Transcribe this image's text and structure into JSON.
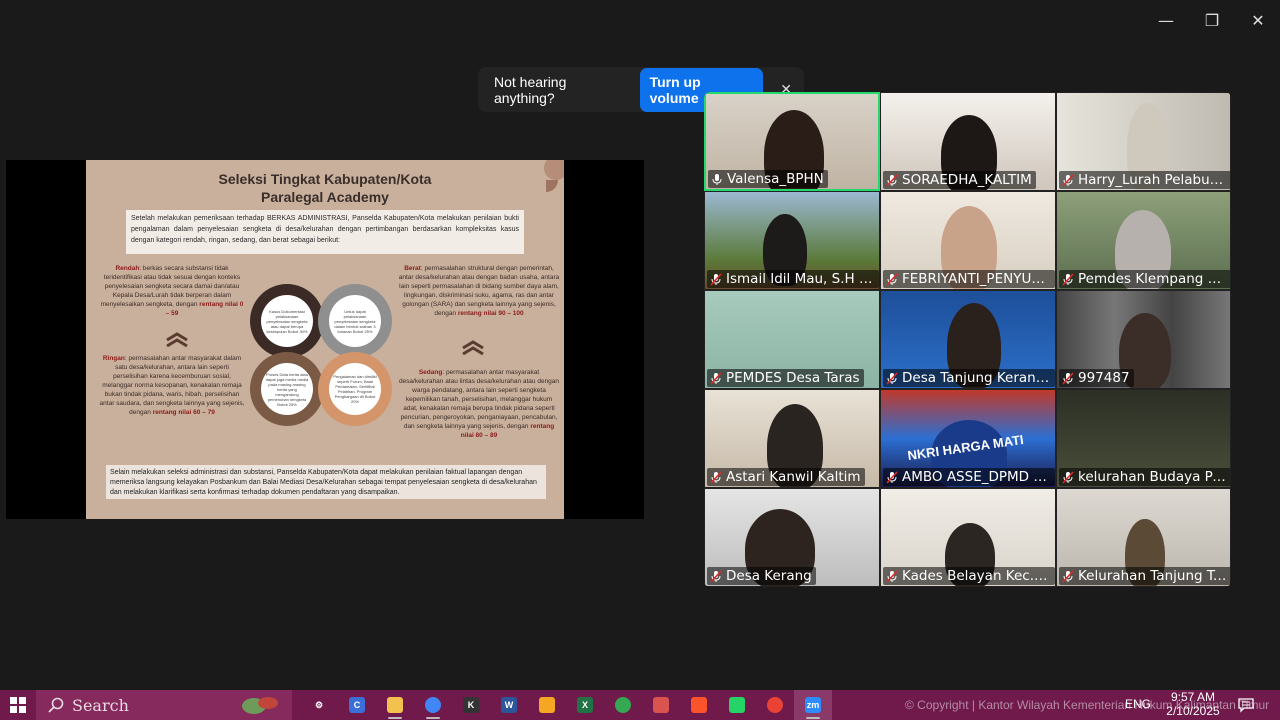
{
  "window": {
    "minimize_icon": "minimize-icon",
    "restore_icon": "restore-icon",
    "close_icon": "close-icon"
  },
  "notification": {
    "message": "Not hearing anything?",
    "button": "Turn up volume",
    "close": "✕"
  },
  "slide": {
    "title_line1": "Seleksi Tingkat Kabupaten/Kota",
    "title_line2": "Paralegal Academy",
    "intro": "Setelah melakukan pemeriksaan terhadap BERKAS ADMINISTRASI, Panselda Kabupaten/Kota melakukan penilaian bukti pengalaman dalam penyelesaian sengketa di desa/kelurahan dengan pertimbangan berdasarkan kompleksitas kasus dengan kategori rendah, ringan, sedang, dan berat sebagai berikut:",
    "rendah_label": "Rendah",
    "rendah_text": ": berkas secara substansi tidak teridentifikasi atau tidak sesuai dengan konteks penyelesaian sengketa secara damai dan/atau Kepala Desa/Lurah tidak berperan dalam menyelesaikan sengketa, dengan",
    "rendah_range": "rentang nilai 0 – 59",
    "ringan_label": "Ringan",
    "ringan_text": ": permasalahan antar masyarakat dalam satu desa/kelurahan, antara lain seperti perselisihan karena kecemburuan sosial, melanggar norma kesopanan, kenakalan remaja bukan tindak pidana, waris, hibah, perselisihan antar saudara, dan sengketa lainnya yang sejenis, dengan",
    "ringan_range": "rentang nilai 60 – 79",
    "berat_label": "Berat",
    "berat_text": ": permasalahan struktural dengan pemerintah, antar desa/kelurahan atau dengan badan usaha, antara lain seperti permasalahan di bidang sumber daya alam, lingkungan, diskriminasi suku, agama, ras dan antar golongan (SARA) dan sengketa lainnya yang sejenis, dengan",
    "berat_range": "rentang nilai 90 – 100",
    "sedang_label": "Sedang",
    "sedang_text": ": permasalahan antar masyarakat desa/kelurahan atau lintas desa/kelurahan atau dengan warga pendatang, antara lain seperti sengketa kepemilikan tanah, perselisihan, melanggar hukum adat, kenakalan remaja berupa tindak pidana seperti pencurian, pengeroyokan, penganiayaan, pencabulan, dan sengketa lainnya yang sejenis, dengan",
    "sedang_range": "rentang nilai 80 – 89",
    "circle1": "Kasus Dokumentasi pelaksanaan penyelesaian sengketa atau dapat berupa kesimpulan Bobot 30%",
    "circle2": "Untuk dapat pelaksanaan penyelesaian sengketa dalam bentuk salinan 3 bulanan Bobot 25%",
    "circle3": "Proses Data berita atau dapat juga media media pada masing-masing berita yang mengandung pemenuhan sengketa Bobot 25%",
    "circle4": "Pengalaman dan dimiliki seperti Forum, Balai Perdamaian, Sertifikat Pelatihan, Program Penghargaan dll Bobot 20%",
    "footer": "Selain melakukan seleksi administrasi dan substansi, Panselda Kabupaten/Kota dapat melakukan penilaian faktual lapangan dengan memeriksa langsung kelayakan Posbankum dan Balai Mediasi Desa/Kelurahan sebagai tempat penyelesaian sengketa di desa/kelurahan dan melakukan klarifikasi serta konfirmasi terhadap dokumen pendaftaran yang disampaikan."
  },
  "participants": [
    {
      "name": "Valensa_BPHN",
      "muted": false,
      "active": true
    },
    {
      "name": "SORAEDHA_KALTIM",
      "muted": true,
      "active": false
    },
    {
      "name": "Harry_Lurah Pelabuhan",
      "muted": true,
      "active": false
    },
    {
      "name": "Ismail Idil Mau, S.H B...",
      "muted": true,
      "active": false
    },
    {
      "name": "FEBRIYANTI_PENYUL...",
      "muted": true,
      "active": false
    },
    {
      "name": "Pemdes Klempang Sari",
      "muted": true,
      "active": false
    },
    {
      "name": "PEMDES Desa Taras",
      "muted": true,
      "active": false
    },
    {
      "name": "Desa Tanjung Keranja...",
      "muted": true,
      "active": false
    },
    {
      "name": "997487",
      "muted": true,
      "active": false
    },
    {
      "name": "Astari Kanwil Kaltim",
      "muted": true,
      "active": false
    },
    {
      "name": "AMBO ASSE_DPMD N...",
      "muted": true,
      "active": false
    },
    {
      "name": "kelurahan Budaya Pa...",
      "muted": true,
      "active": false
    },
    {
      "name": "Desa Kerang",
      "muted": true,
      "active": false
    },
    {
      "name": "Kades Belayan Kec.Ma...",
      "muted": true,
      "active": false
    },
    {
      "name": "Kelurahan Tanjung Te...",
      "muted": true,
      "active": false
    }
  ],
  "tile4_banner_text": "NKRI HARGA MATI",
  "taskbar": {
    "search_placeholder": "Search",
    "copyright": "© Copyright | Kantor Wilayah Kementerian Hukum Kalimantan Timur",
    "language": "ENG",
    "time": "9:57 AM",
    "date": "2/10/2025",
    "apps": [
      {
        "name": "settings-icon",
        "label": "⚙",
        "color": "#6f1a4b"
      },
      {
        "name": "copilot-icon",
        "label": "C",
        "color": "#3b6fd8"
      },
      {
        "name": "file-explorer-icon",
        "label": "",
        "color": "#f2c14e"
      },
      {
        "name": "chrome-icon",
        "label": "",
        "color": "#4285f4"
      },
      {
        "name": "app-k-icon",
        "label": "K",
        "color": "#333"
      },
      {
        "name": "word-icon",
        "label": "W",
        "color": "#2b579a"
      },
      {
        "name": "orange-app-icon",
        "label": "",
        "color": "#f5a623"
      },
      {
        "name": "excel-icon",
        "label": "X",
        "color": "#217346"
      },
      {
        "name": "chrome-profile-icon",
        "label": "",
        "color": "#34a853"
      },
      {
        "name": "grid-app-icon",
        "label": "",
        "color": "#d9534f"
      },
      {
        "name": "brave-icon",
        "label": "",
        "color": "#fb542b"
      },
      {
        "name": "whatsapp-icon",
        "label": "",
        "color": "#25d366"
      },
      {
        "name": "chrome-alt-icon",
        "label": "",
        "color": "#ea4335"
      },
      {
        "name": "zoom-icon",
        "label": "zm",
        "color": "#2d8cff"
      }
    ]
  }
}
